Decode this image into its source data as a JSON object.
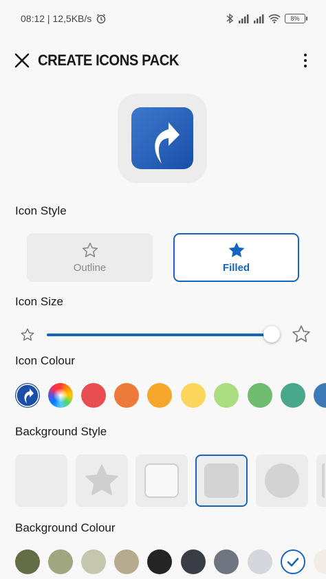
{
  "status_bar": {
    "time_speed": "08:12 | 12,5KB/s",
    "battery": "8%"
  },
  "app_bar": {
    "title": "CREATE ICONS PACK"
  },
  "sections": {
    "icon_style": "Icon Style",
    "icon_size": "Icon Size",
    "icon_colour": "Icon Colour",
    "background_style": "Background Style",
    "background_colour": "Background Colour"
  },
  "icon_style_options": {
    "outline": "Outline",
    "filled": "Filled",
    "selected": "Filled"
  },
  "icon_size": {
    "level": 0.96
  },
  "icon_colours": [
    "#1a4ea8",
    "rainbow",
    "#e84e52",
    "#ec7a3a",
    "#f6a72b",
    "#fbd65a",
    "#a9dd80",
    "#6fbb6f",
    "#49a889",
    "#3f7ab8"
  ],
  "background_styles": [
    "none",
    "star",
    "outline-square",
    "filled-square",
    "circle",
    "partial"
  ],
  "background_style_selected": "filled-square",
  "background_colours": [
    "#636e46",
    "#a0a67f",
    "#c4c6ad",
    "#b6ab8e",
    "#242424",
    "#3a3d46",
    "#6f7480",
    "#d5d7dc",
    "#ffffff",
    "#f1ece6"
  ],
  "background_colour_selected": 8,
  "colors": {
    "accent": "#1565c0"
  }
}
